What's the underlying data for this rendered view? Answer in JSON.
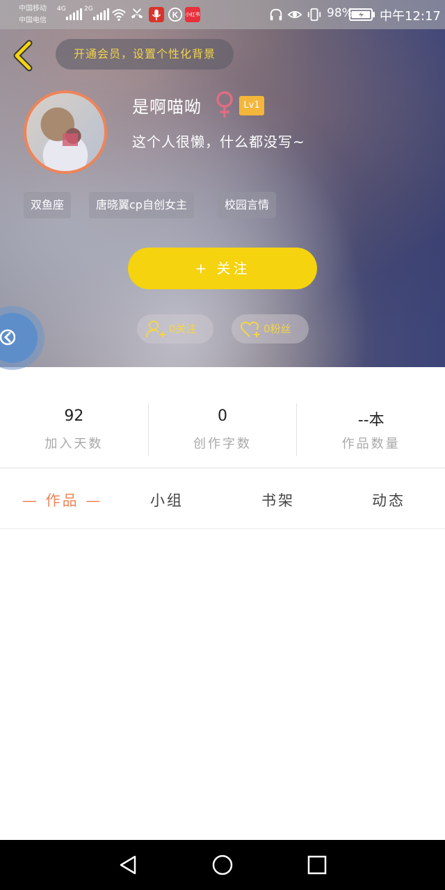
{
  "status_bar": {
    "carrier1": "中国移动",
    "carrier2": "中国电信",
    "net1": "4G",
    "net2": "2G",
    "xhs_badge": "小红书",
    "battery_pct": "98%",
    "time": "中午12:17"
  },
  "header": {
    "vip_banner": "开通会员，设置个性化背景"
  },
  "profile": {
    "username": "是啊喵呦",
    "level": "Lv1",
    "bio": "这个人很懒，什么都没写~",
    "tags": [
      "双鱼座",
      "唐晓翼cp自创女主",
      "校园言情"
    ]
  },
  "actions": {
    "follow_label": "+  关注",
    "following_label": "0关注",
    "fans_label": "0粉丝"
  },
  "stats": [
    {
      "value": "92",
      "label": "加入天数"
    },
    {
      "value": "0",
      "label": "创作字数"
    },
    {
      "value": "--本",
      "label": "作品数量"
    }
  ],
  "tabs": [
    {
      "label": "— 作品 —",
      "active": true
    },
    {
      "label": "小组",
      "active": false
    },
    {
      "label": "书架",
      "active": false
    },
    {
      "label": "动态",
      "active": false
    }
  ],
  "colors": {
    "accent_yellow": "#f5d30e",
    "accent_orange": "#ef8458",
    "level_badge": "#f4b63b"
  }
}
